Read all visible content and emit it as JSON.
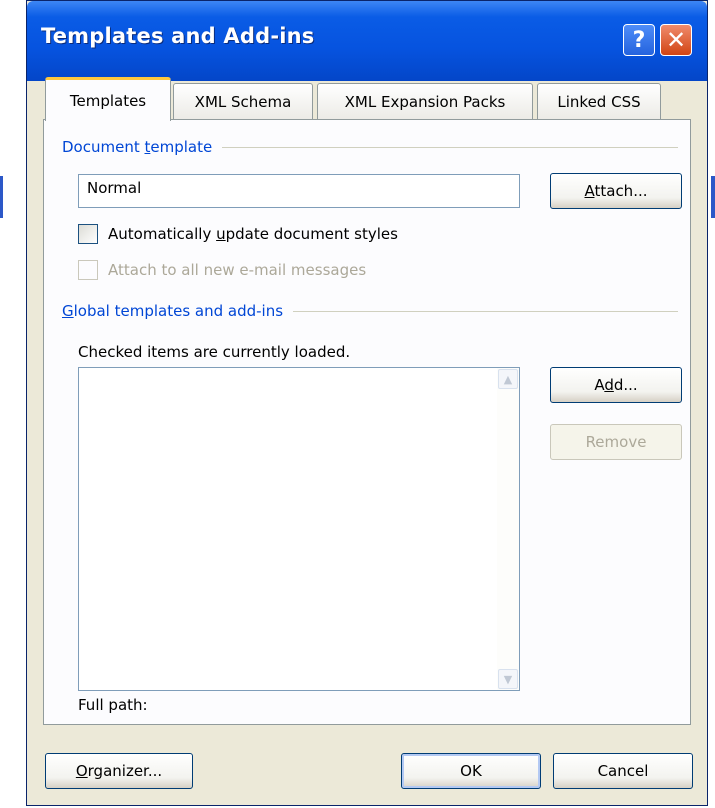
{
  "window": {
    "title": "Templates and Add-ins",
    "help_label": "?",
    "close_label": "✕"
  },
  "tabs": [
    {
      "label": "Templates",
      "active": true
    },
    {
      "label": "XML Schema",
      "active": false
    },
    {
      "label": "XML Expansion Packs",
      "active": false
    },
    {
      "label": "Linked CSS",
      "active": false
    }
  ],
  "document_template": {
    "header_pre": "Document ",
    "header_key": "t",
    "header_post": "emplate",
    "value": "Normal",
    "attach_key": "A",
    "attach_rest": "ttach..."
  },
  "auto_update": {
    "label_pre": "Automatically ",
    "label_key": "u",
    "label_post": "pdate document styles",
    "checked": false
  },
  "attach_email": {
    "label": "Attach to all new e-mail messages",
    "checked": false,
    "enabled": false
  },
  "global_templates": {
    "header_key": "G",
    "header_rest": "lobal templates and add-ins",
    "note": "Checked items are currently loaded.",
    "items": [],
    "add_pre": "A",
    "add_key": "d",
    "add_post": "d...",
    "remove_label": "Remove"
  },
  "full_path": {
    "label": "Full path:",
    "value": ""
  },
  "footer": {
    "organizer_key": "O",
    "organizer_rest": "rganizer...",
    "ok_label": "OK",
    "cancel_label": "Cancel"
  }
}
